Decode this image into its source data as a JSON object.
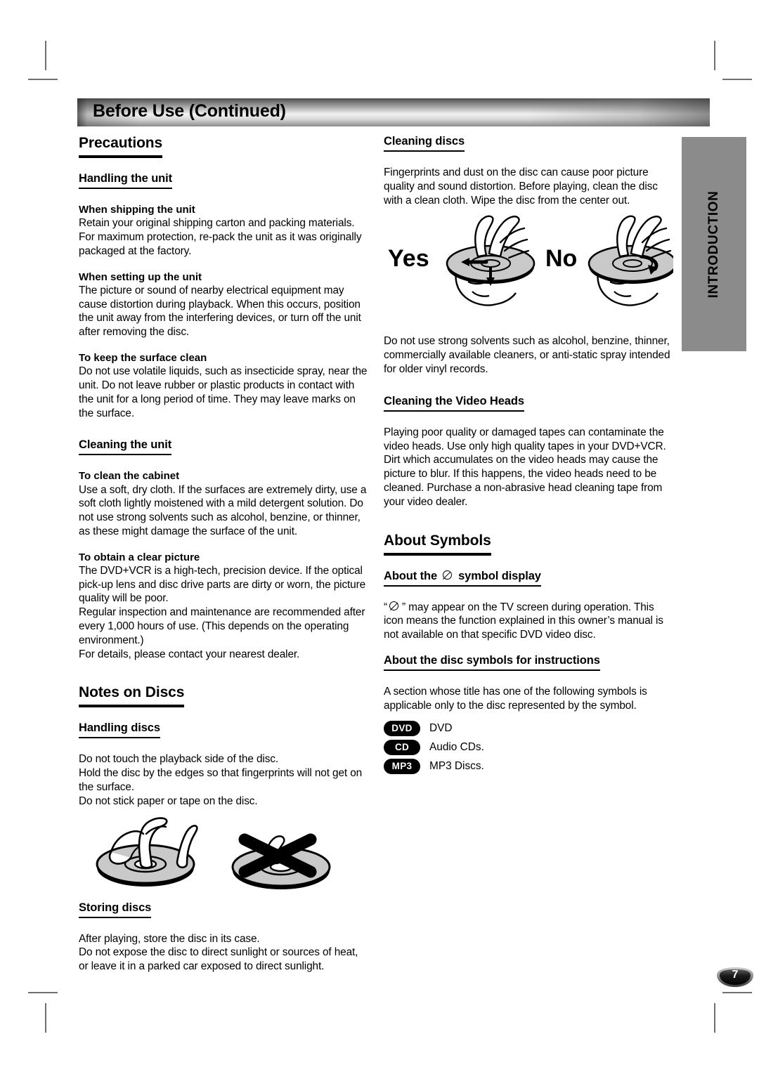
{
  "header": {
    "title": "Before Use (Continued)"
  },
  "side_tab": {
    "label": "INTRODUCTION"
  },
  "page_number": "7",
  "left_column": {
    "section_precautions": {
      "title": "Precautions",
      "sub_handling_unit": "Handling the unit",
      "minor_shipping": "When shipping the unit",
      "body_shipping": "Retain your original shipping carton and packing materials. For maximum protection, re-pack the unit as it was originally packaged at the factory.",
      "minor_setting_up": "When setting up the unit",
      "body_setting_up": "The picture or sound of nearby electrical equipment may cause distortion during playback. When this occurs, position the unit away from the interfering devices, or turn off the unit after removing the disc.",
      "minor_surface_clean": "To keep the surface clean",
      "body_surface_clean": "Do not use volatile liquids, such as insecticide spray, near the unit. Do not leave rubber or plastic products in contact with the unit for a long period of time. They may leave marks on the surface.",
      "sub_cleaning_unit": "Cleaning the unit",
      "minor_clean_cabinet": "To clean the cabinet",
      "body_clean_cabinet": "Use a soft, dry cloth. If the surfaces are extremely dirty, use a soft cloth lightly moistened with a mild detergent solution. Do not use strong solvents such as alcohol, benzine, or thinner, as these might damage the surface of the unit.",
      "minor_clear_picture": "To obtain a clear picture",
      "body_clear_picture_1": "The DVD+VCR is a high-tech, precision device. If the optical pick-up lens and disc drive parts are dirty or worn, the picture quality will be poor.",
      "body_clear_picture_2": "Regular inspection and maintenance are recommended after every 1,000 hours of use. (This depends on the operating environment.)",
      "body_clear_picture_3": "For details, please contact your nearest dealer."
    },
    "section_notes_discs": {
      "title": "Notes on Discs",
      "sub_handling_discs": "Handling discs",
      "body_handling_discs_1": "Do not touch the playback side of the disc.",
      "body_handling_discs_2": "Hold the disc by the edges so that fingerprints will not get on the surface.",
      "body_handling_discs_3": "Do not stick paper or tape on the disc.",
      "figure_handling_discs": "disc-handling-illustration",
      "sub_storing_discs": "Storing discs",
      "body_storing_discs_1": "After playing, store the disc in its case.",
      "body_storing_discs_2": "Do not expose the disc to direct sunlight or sources of heat, or leave it in a parked car exposed to direct sunlight."
    }
  },
  "right_column": {
    "sub_cleaning_discs": "Cleaning discs",
    "body_cleaning_discs": "Fingerprints and dust on the disc can cause poor picture quality and sound distortion. Before playing, clean the disc with a clean cloth. Wipe the disc from the center out.",
    "figure_yesno": {
      "name": "disc-wipe-illustration",
      "yes_label": "Yes",
      "no_label": "No"
    },
    "body_solvents": "Do not use strong solvents such as alcohol, benzine, thinner, commercially available cleaners, or anti-static spray intended for older vinyl records.",
    "sub_video_heads": "Cleaning the Video Heads",
    "body_video_heads": "Playing poor quality or damaged tapes can contaminate the video heads. Use only high quality tapes in your DVD+VCR. Dirt which accumulates on the video heads may cause the picture to blur. If this happens, the video heads need to be cleaned. Purchase a non-abrasive head cleaning tape from your video dealer.",
    "section_about_symbols": {
      "title": "About Symbols",
      "sub_symbol_display_before": "About the",
      "sub_symbol_display_after": "symbol display",
      "body_symbol_display_a": "“",
      "body_symbol_display_b": "” may appear on the TV screen during operation. This icon means the function explained in this owner’s manual is not available on that specific DVD video disc.",
      "sub_disc_symbols": "About the disc symbols for instructions",
      "body_disc_symbols": "A section whose title has one of the following symbols is applicable only to the disc represented by the symbol.",
      "badges": [
        {
          "label": "DVD",
          "text": "DVD"
        },
        {
          "label": "CD",
          "text": "Audio CDs."
        },
        {
          "label": "MP3",
          "text": "MP3 Discs."
        }
      ]
    }
  },
  "colors": {
    "side_tab_bg": "#8b8b8b",
    "badge_bg": "#000000",
    "crop_mark": "#6f6f6f"
  }
}
